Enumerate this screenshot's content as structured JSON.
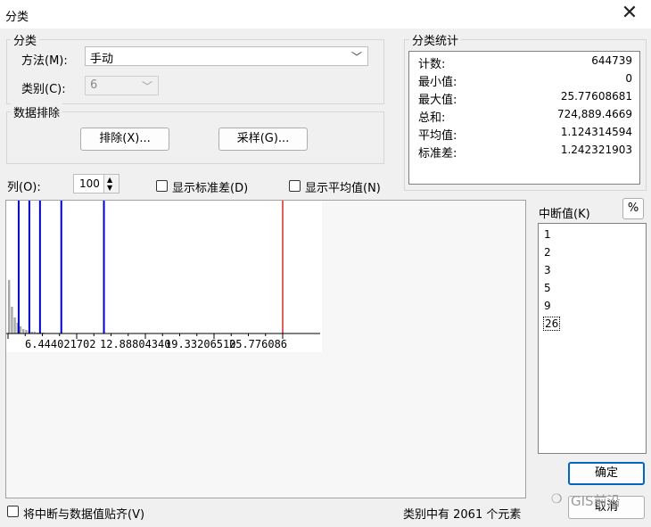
{
  "window": {
    "title": "分类",
    "close_glyph": "✕"
  },
  "classification": {
    "group_label": "分类",
    "method_label": "方法(M):",
    "method_value": "手动",
    "classes_label": "类别(C):",
    "classes_value": "6"
  },
  "exclusion": {
    "group_label": "数据排除",
    "exclude_button": "排除(X)...",
    "sample_button": "采样(G)..."
  },
  "stats": {
    "group_label": "分类统计",
    "rows": [
      {
        "key": "计数:",
        "value": "644739"
      },
      {
        "key": "最小值:",
        "value": "0"
      },
      {
        "key": "最大值:",
        "value": "25.77608681"
      },
      {
        "key": "总和:",
        "value": "724,889.4669"
      },
      {
        "key": "平均值:",
        "value": "1.124314594"
      },
      {
        "key": "标准差:",
        "value": "1.242321903"
      }
    ]
  },
  "columns": {
    "label": "列(O):",
    "value": "100"
  },
  "options": {
    "show_std_label": "显示标准差(D)",
    "show_mean_label": "显示平均值(N)",
    "snap_label": "将中断与数据值贴齐(V)"
  },
  "breaks": {
    "label": "中断值(K)",
    "percent_button": "%",
    "values": [
      "1",
      "2",
      "3",
      "5",
      "9",
      "26"
    ]
  },
  "histogram": {
    "tick_labels": [
      "6.444021702",
      "12.88804340",
      "19.33206510",
      "25.776086"
    ],
    "break_line_color": "#0000cc",
    "max_line_color": "#e06060",
    "bar_color": "#a8a8a8"
  },
  "footer": {
    "count_text": "类别中有 2061 个元素",
    "ok_button": "确定",
    "cancel_button": "取消",
    "watermark": "GIS前沿"
  }
}
